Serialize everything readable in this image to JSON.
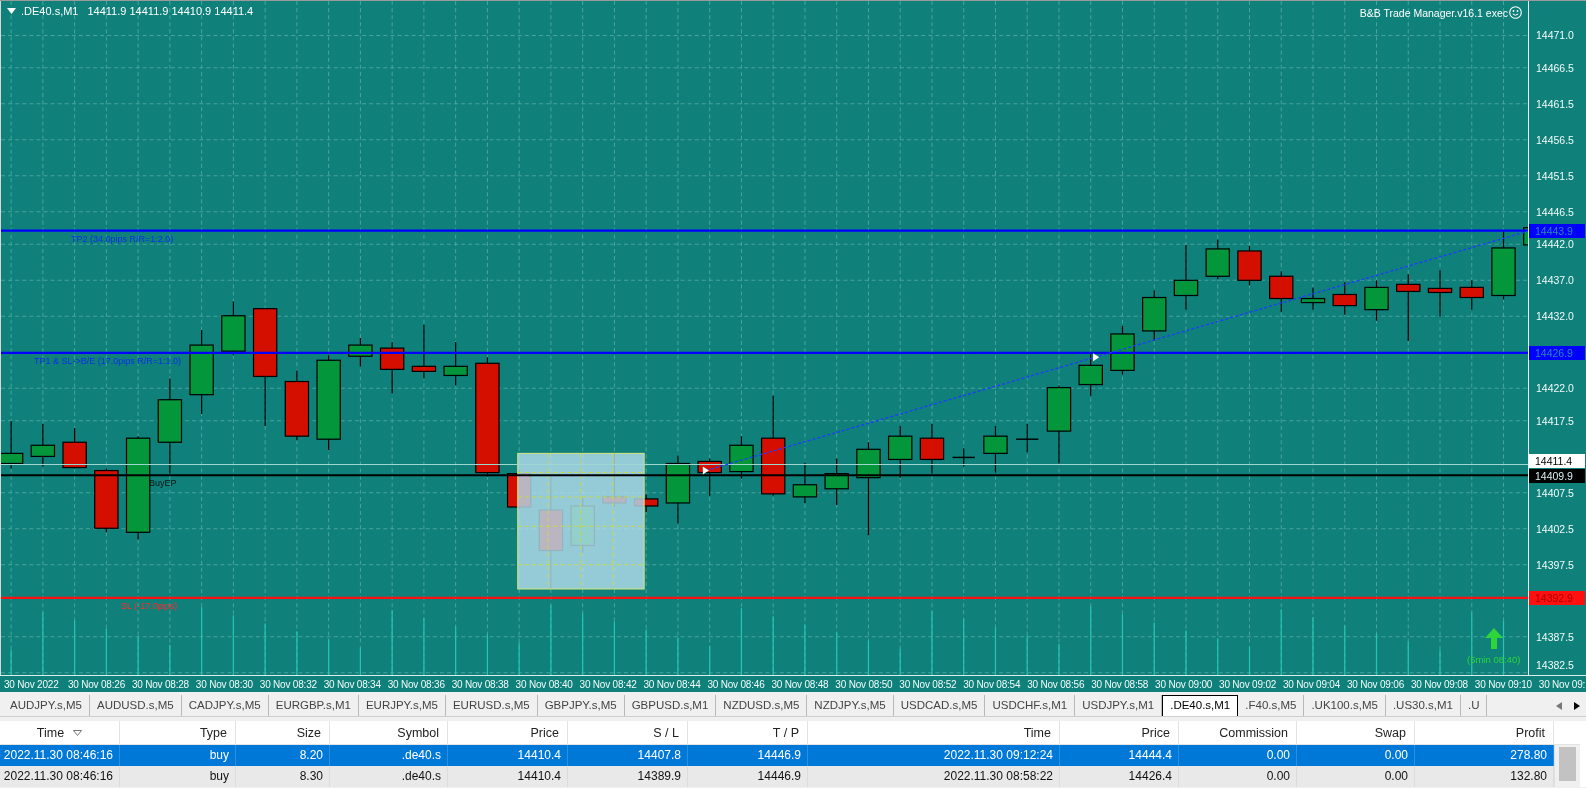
{
  "chart": {
    "symbol": ".DE40.s,M1",
    "ohlc": "14411.9 14411.9 14410.9 14411.4",
    "indicator": "B&B Trade Manager.v16.1 exec",
    "price_axis": [
      "14471.0",
      "14466.5",
      "14461.5",
      "14456.5",
      "14451.5",
      "14446.5",
      "14442.0",
      "14437.0",
      "14432.0",
      "14422.0",
      "14417.5",
      "14407.5",
      "14402.5",
      "14397.5",
      "14387.5",
      "14382.5"
    ],
    "levels": [
      {
        "kind": "tp",
        "label": "TP2 (34.0pips R/R=1:2.0)",
        "price": "14443.9"
      },
      {
        "kind": "tp",
        "label": "TP1 & SL->B/E (17.0pips R/R=1:1.0)",
        "price": "14426.9"
      },
      {
        "kind": "bid",
        "price": "14411.4"
      },
      {
        "kind": "entry",
        "label": "BuyEP",
        "price": "14409.9"
      },
      {
        "kind": "sl",
        "label": "SL (-17.0pips)",
        "price": "14392.9"
      }
    ],
    "signal": {
      "label": "(5min 08:40)"
    },
    "time_axis": [
      "30 Nov 2022",
      "30 Nov 08:26",
      "30 Nov 08:28",
      "30 Nov 08:30",
      "30 Nov 08:32",
      "30 Nov 08:34",
      "30 Nov 08:36",
      "30 Nov 08:38",
      "30 Nov 08:40",
      "30 Nov 08:42",
      "30 Nov 08:44",
      "30 Nov 08:46",
      "30 Nov 08:48",
      "30 Nov 08:50",
      "30 Nov 08:52",
      "30 Nov 08:54",
      "30 Nov 08:56",
      "30 Nov 08:58",
      "30 Nov 09:00",
      "30 Nov 09:02",
      "30 Nov 09:04",
      "30 Nov 09:06",
      "30 Nov 09:08",
      "30 Nov 09:10",
      "30 Nov 09:"
    ]
  },
  "tabs": [
    {
      "label": "AUDJPY.s,M5",
      "selected": false
    },
    {
      "label": "AUDUSD.s,M5",
      "selected": false
    },
    {
      "label": "CADJPY.s,M5",
      "selected": false
    },
    {
      "label": "EURGBP.s,M1",
      "selected": false
    },
    {
      "label": "EURJPY.s,M5",
      "selected": false
    },
    {
      "label": "EURUSD.s,M5",
      "selected": false
    },
    {
      "label": "GBPJPY.s,M5",
      "selected": false
    },
    {
      "label": "GBPUSD.s,M1",
      "selected": false
    },
    {
      "label": "NZDUSD.s,M5",
      "selected": false
    },
    {
      "label": "NZDJPY.s,M5",
      "selected": false
    },
    {
      "label": "USDCAD.s,M5",
      "selected": false
    },
    {
      "label": "USDCHF.s,M1",
      "selected": false
    },
    {
      "label": "USDJPY.s,M1",
      "selected": false
    },
    {
      "label": ".DE40.s,M1",
      "selected": true
    },
    {
      "label": ".F40.s,M5",
      "selected": false
    },
    {
      "label": ".UK100.s,M5",
      "selected": false
    },
    {
      "label": ".US30.s,M1",
      "selected": false
    },
    {
      "label": ".U",
      "selected": false
    }
  ],
  "table": {
    "columns": [
      {
        "label": "Time",
        "sorted": true
      },
      {
        "label": "Type",
        "sorted": false
      },
      {
        "label": "Size",
        "sorted": false
      },
      {
        "label": "Symbol",
        "sorted": false
      },
      {
        "label": "Price",
        "sorted": false
      },
      {
        "label": "S / L",
        "sorted": false
      },
      {
        "label": "T / P",
        "sorted": false
      },
      {
        "label": "Time",
        "sorted": false
      },
      {
        "label": "Price",
        "sorted": false
      },
      {
        "label": "Commission",
        "sorted": false
      },
      {
        "label": "Swap",
        "sorted": false
      },
      {
        "label": "Profit",
        "sorted": false
      }
    ],
    "rows": [
      {
        "selected": true,
        "cells": [
          "2022.11.30 08:46:16",
          "buy",
          "8.20",
          ".de40.s",
          "14410.4",
          "14407.8",
          "14446.9",
          "2022.11.30 09:12:24",
          "14444.4",
          "0.00",
          "0.00",
          "278.80"
        ]
      },
      {
        "selected": false,
        "cells": [
          "2022.11.30 08:46:16",
          "buy",
          "8.30",
          ".de40.s",
          "14410.4",
          "14389.9",
          "14446.9",
          "2022.11.30 08:58:22",
          "14426.4",
          "0.00",
          "0.00",
          "132.80"
        ]
      }
    ]
  }
}
